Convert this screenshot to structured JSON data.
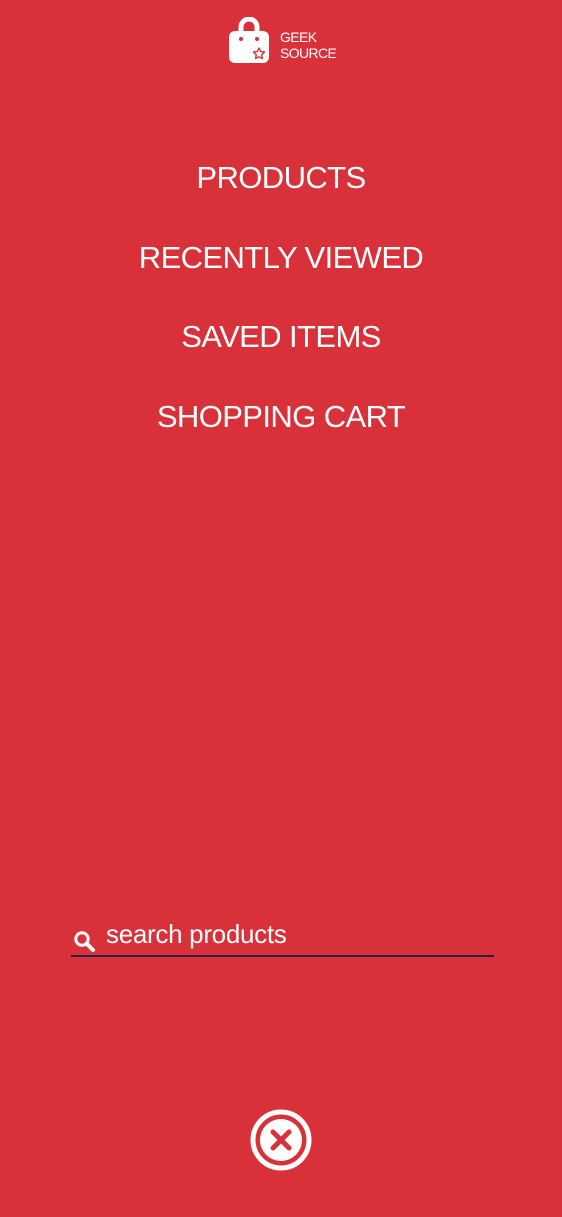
{
  "brand": {
    "line1": "GEEK",
    "line2": "SOURCE",
    "logo_icon": "shopping-bag-star-icon"
  },
  "nav": {
    "items": [
      {
        "label": "PRODUCTS"
      },
      {
        "label": "RECENTLY VIEWED"
      },
      {
        "label": "SAVED ITEMS"
      },
      {
        "label": "SHOPPING CART"
      }
    ]
  },
  "search": {
    "placeholder": "search products",
    "value": "",
    "icon": "search-icon"
  },
  "close": {
    "icon": "close-circle-icon"
  },
  "colors": {
    "background": "#d8313a",
    "text": "#ffffff",
    "search_underline": "#2a2340"
  }
}
